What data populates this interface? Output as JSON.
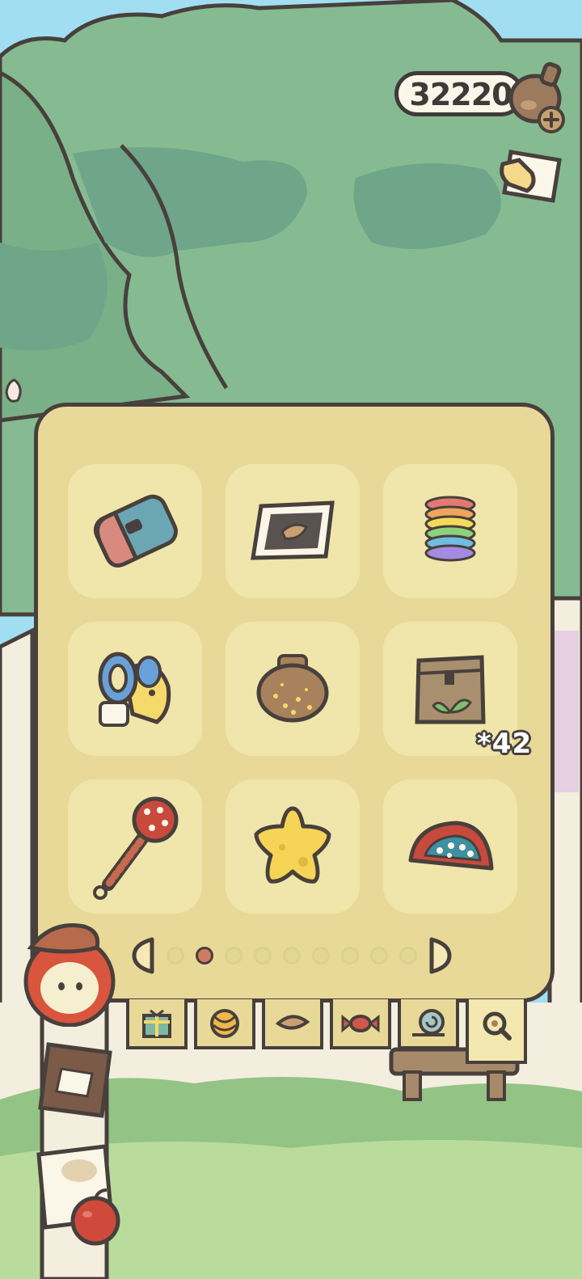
{
  "currency": {
    "amount": "32220",
    "icon": "acorn-icon",
    "add_icon": "plus-icon"
  },
  "inventory": {
    "items": [
      {
        "icon": "blue-pencil-case-icon"
      },
      {
        "icon": "framed-picture-icon"
      },
      {
        "icon": "rainbow-slinky-icon"
      },
      {
        "icon": "bubble-wand-toy-icon"
      },
      {
        "icon": "clay-pot-icon"
      },
      {
        "icon": "seed-bag-icon",
        "count": "*42"
      },
      {
        "icon": "maraca-rattle-icon"
      },
      {
        "icon": "yellow-star-cushion-icon"
      },
      {
        "icon": "red-hat-icon"
      }
    ],
    "pages": 9,
    "current_page": 2
  },
  "tabs": [
    {
      "icon": "gift-icon"
    },
    {
      "icon": "yarn-ball-icon"
    },
    {
      "icon": "leaf-icon"
    },
    {
      "icon": "candy-icon"
    },
    {
      "icon": "snail-icon"
    },
    {
      "icon": "magnifier-icon",
      "active": true
    }
  ],
  "colors": {
    "panel": "#e8d998",
    "slot": "#f0e6ab",
    "outline": "#48403c",
    "active_dot": "#d07a64"
  }
}
